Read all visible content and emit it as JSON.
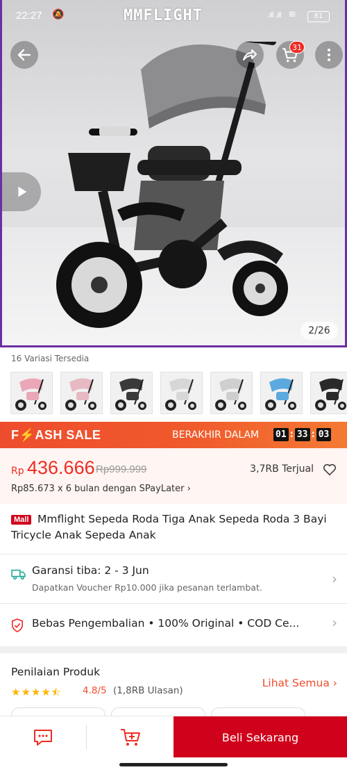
{
  "status_bar": {
    "time": "22:27",
    "brand": "MMFLIGHT",
    "battery": "81"
  },
  "gallery": {
    "counter": "2/26",
    "cart_count": "31"
  },
  "variations": {
    "title": "16 Variasi Tersedia",
    "thumb_colors": [
      "#e9a7b8",
      "#e6b9c3",
      "#3a3a3a",
      "#d7d7d7",
      "#cfcfcf",
      "#5aa9df",
      "#2a2a2a"
    ]
  },
  "flash_sale": {
    "label_prefix": "F",
    "label_bolt": "⚡",
    "label_suffix": "ASH SALE",
    "ends_label": "BERAKHIR DALAM",
    "hours": "01",
    "minutes": "33",
    "seconds": "03"
  },
  "price": {
    "currency": "Rp",
    "current": "436.666",
    "original": "Rp999.999",
    "sold": "3,7RB Terjual",
    "installment": "Rp85.673 x 6 bulan dengan SPayLater ›"
  },
  "product": {
    "mall_badge": "Mall",
    "title": "Mmflight Sepeda Roda Tiga Anak Sepeda Roda 3 Bayi Tricycle Anak Sepeda Anak"
  },
  "shipping": {
    "title": "Garansi tiba: 2 - 3 Jun",
    "subtitle": "Dapatkan Voucher Rp10.000 jika pesanan terlambat."
  },
  "guarantee": {
    "text": "Bebas Pengembalian  •  100% Original  •  COD Ce..."
  },
  "reviews": {
    "title": "Penilaian Produk",
    "stars": "★★★★⯪",
    "score": "4.8/5",
    "count": "(1,8RB Ulasan)",
    "see_all": "Lihat Semua"
  },
  "bottom": {
    "buy_label": "Beli Sekarang"
  },
  "colors": {
    "accent": "#ee4d2d",
    "buy_red": "#d0011b",
    "flash_bolt": "#ffd43a"
  }
}
